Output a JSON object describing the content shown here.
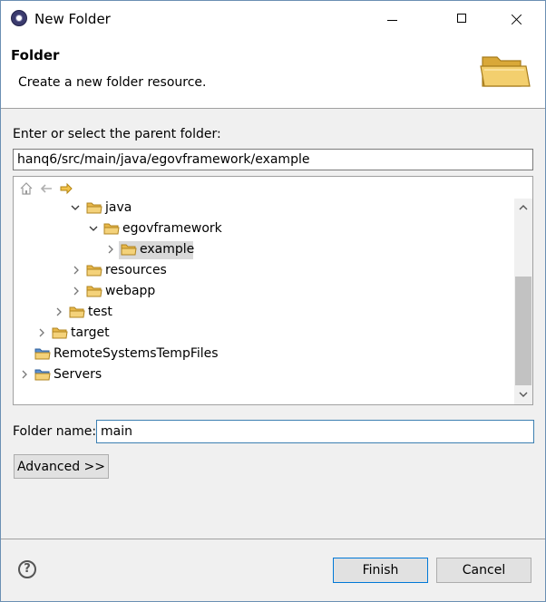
{
  "window": {
    "title": "New Folder"
  },
  "header": {
    "title": "Folder",
    "description": "Create a new folder resource.",
    "icon": "open-folder-icon"
  },
  "parent": {
    "label": "Enter or select the parent folder:",
    "value": "hanq6/src/main/java/egovframework/example"
  },
  "tree": {
    "items": [
      {
        "label": "java",
        "expanded": true,
        "icon": "folder-icon"
      },
      {
        "label": "egovframework",
        "expanded": true,
        "icon": "folder-icon"
      },
      {
        "label": "example",
        "expanded": false,
        "selected": true,
        "icon": "folder-icon"
      },
      {
        "label": "resources",
        "expanded": false,
        "icon": "folder-icon"
      },
      {
        "label": "webapp",
        "expanded": false,
        "icon": "folder-icon"
      },
      {
        "label": "test",
        "expanded": false,
        "icon": "folder-icon"
      },
      {
        "label": "target",
        "expanded": false,
        "icon": "folder-icon"
      },
      {
        "label": "RemoteSystemsTempFiles",
        "icon": "project-icon"
      },
      {
        "label": "Servers",
        "expanded": false,
        "icon": "project-icon"
      }
    ]
  },
  "folder_name": {
    "label": "Folder name:",
    "value": "main"
  },
  "buttons": {
    "advanced": "Advanced >>",
    "finish": "Finish",
    "cancel": "Cancel"
  },
  "colors": {
    "folder": "#e8b84a",
    "accent": "#0078d7",
    "selection": "#d9d9d9"
  }
}
